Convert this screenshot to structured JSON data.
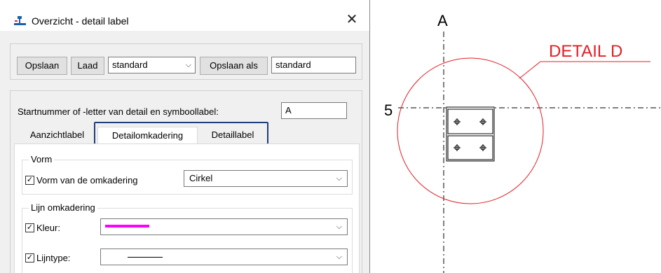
{
  "dialog": {
    "title": "Overzicht - detail label",
    "close_glyph": "✕",
    "toolbar": {
      "save_label": "Opslaan",
      "load_label": "Laad",
      "preset_value": "standard",
      "save_as_label": "Opslaan als",
      "save_as_value": "standard"
    },
    "start_label": "Startnummer of -letter van detail en symboollabel:",
    "start_value": "A",
    "tabs": [
      {
        "label": "Aanzichtlabel"
      },
      {
        "label": "Detailomkadering"
      },
      {
        "label": "Detaillabel"
      }
    ],
    "vorm": {
      "group_title": "Vorm",
      "checkbox_label": "Vorm van de omkadering",
      "checked": true,
      "shape_value": "Cirkel"
    },
    "lijn": {
      "group_title": "Lijn omkadering",
      "kleur_label": "Kleur:",
      "kleur_color": "#ff00ff",
      "lijntype_label": "Lijntype:"
    }
  },
  "drawing": {
    "axis_letter": "A",
    "axis_number": "5",
    "detail_label": "DETAIL D",
    "circle_color": "#e41e26",
    "label_color": "#e41e26"
  }
}
